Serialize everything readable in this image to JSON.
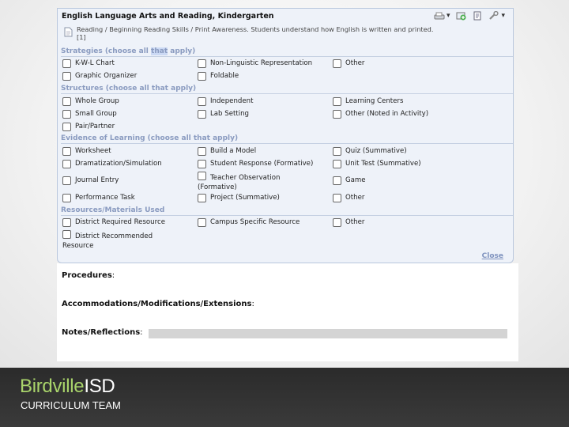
{
  "panel": {
    "title": "English Language Arts and Reading, Kindergarten",
    "standard_text_pre": "Reading / Beginning Reading Skills / Print Awareness. Students understand how English is written and printed.",
    "standard_text_ref": "[1]",
    "toolbar": [
      {
        "icon": "scanner-icon",
        "dropdown": true
      },
      {
        "icon": "add-icon",
        "dropdown": false
      },
      {
        "icon": "edit-document-icon",
        "dropdown": false
      },
      {
        "icon": "wrench-icon",
        "dropdown": true
      }
    ],
    "close_label": "Close"
  },
  "sections": {
    "strategies": {
      "heading_pre": "Strategies (choose all ",
      "heading_highlight": "that",
      "heading_post": " apply)",
      "items": [
        "K-W-L Chart",
        "Non-Linguistic Representation",
        "Other",
        "Graphic Organizer",
        "Foldable"
      ]
    },
    "structures": {
      "heading": "Structures (choose all that apply)",
      "items": [
        "Whole Group",
        "Independent",
        "Learning Centers",
        "Small Group",
        "Lab Setting",
        "Other (Noted in Activity)",
        "Pair/Partner"
      ]
    },
    "evidence": {
      "heading": "Evidence of Learning (choose all that apply)",
      "items": [
        "Worksheet",
        "Build a Model",
        "Quiz (Summative)",
        "Dramatization/Simulation",
        "Student Response (Formative)",
        "Unit Test (Summative)",
        "Journal Entry",
        "Teacher Observation (Formative)",
        "Game",
        "Performance Task",
        "Project (Summative)",
        "Other"
      ]
    },
    "resources": {
      "heading": "Resources/Materials Used",
      "items": [
        "District Required Resource",
        "Campus Specific Resource",
        "Other",
        "District Recommended Resource"
      ]
    }
  },
  "document": {
    "procedures": "Procedures",
    "accommodations": "Accommodations/Modifications/Extensions",
    "notes": "Notes/Reflections",
    "colon": ":"
  },
  "footer": {
    "brand_green": "Birdville",
    "brand_white": "ISD",
    "team": "CURRICULUM TEAM"
  },
  "colors": {
    "section_heading": "#8a9bc0",
    "panel_bg": "#eef2f9",
    "brand_green": "#a9d46b",
    "footer_bg": "#2b2b2b"
  }
}
